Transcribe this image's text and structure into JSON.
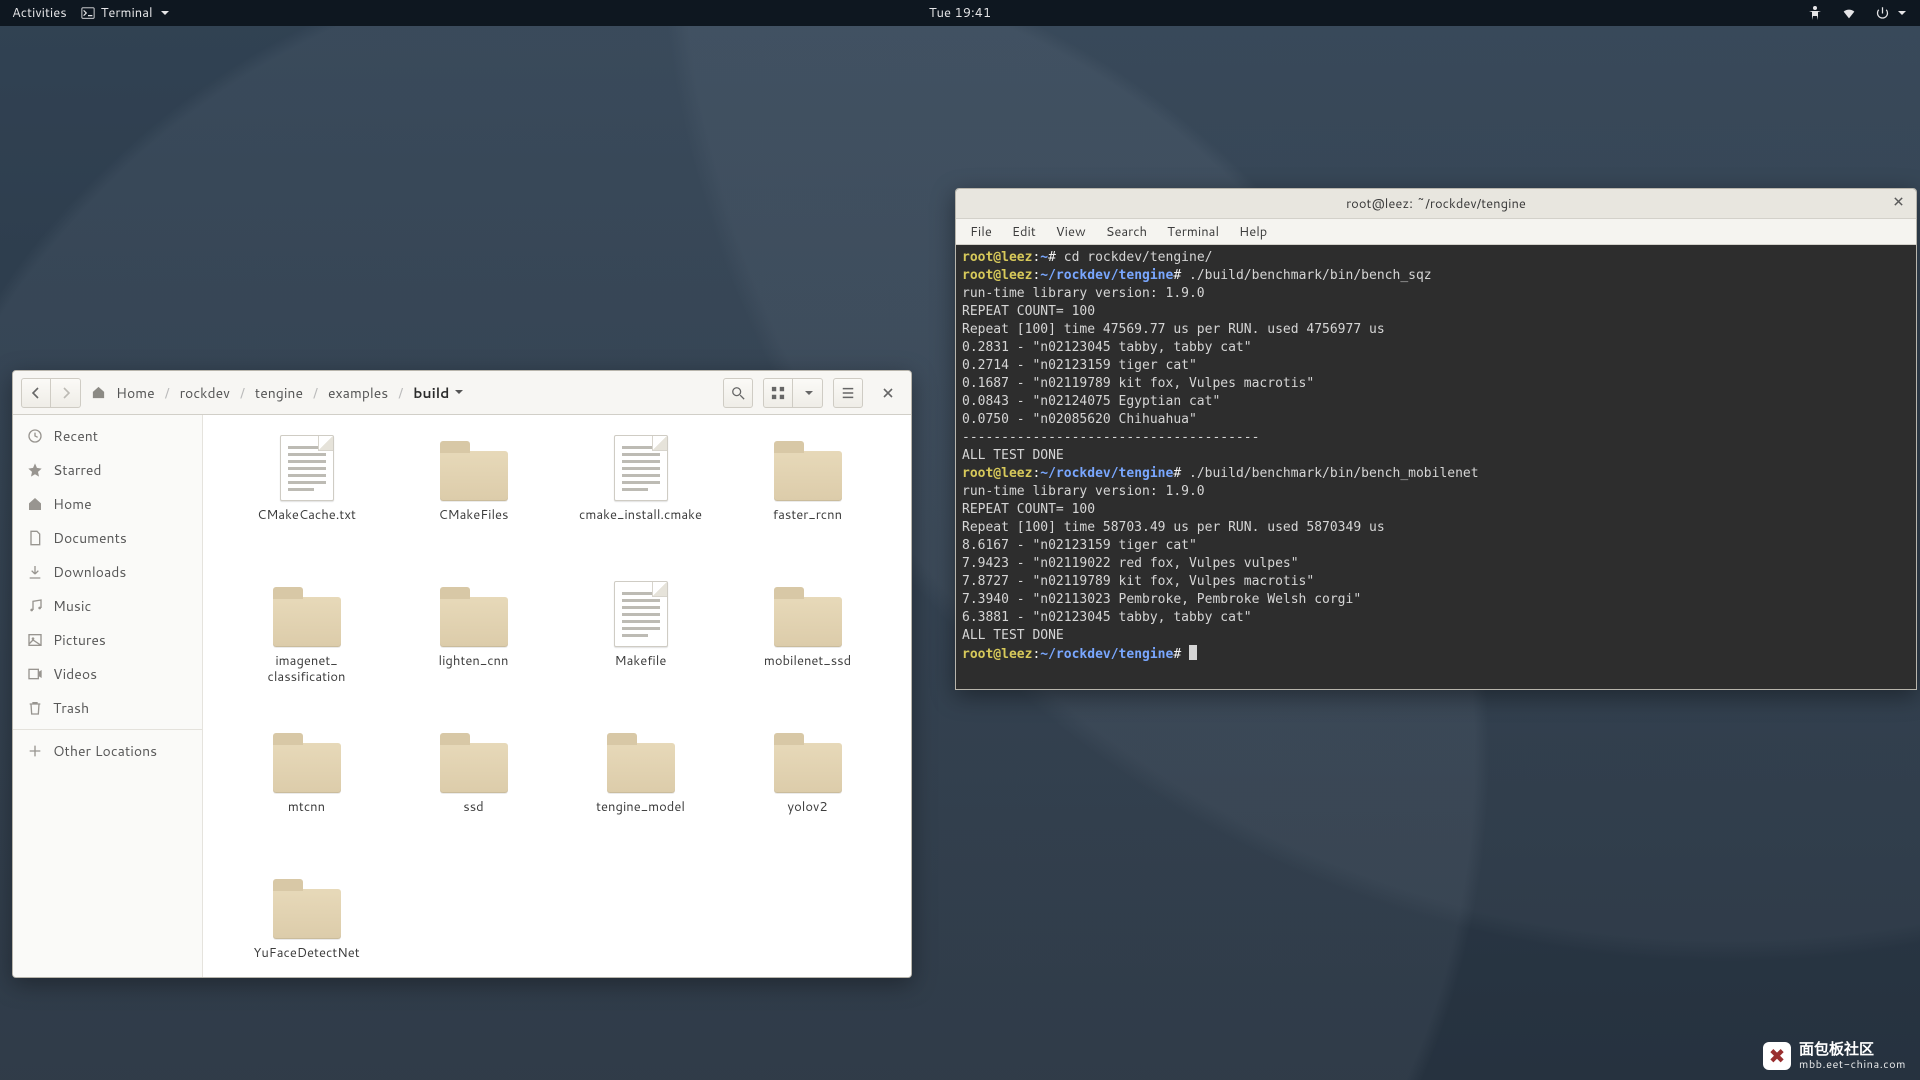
{
  "topbar": {
    "activities": "Activities",
    "app_label": "Terminal",
    "clock": "Tue 19:41"
  },
  "files": {
    "breadcrumb": [
      "Home",
      "rockdev",
      "tengine",
      "examples",
      "build"
    ],
    "sidebar": [
      {
        "icon": "clock",
        "label": "Recent"
      },
      {
        "icon": "star",
        "label": "Starred"
      },
      {
        "icon": "home",
        "label": "Home"
      },
      {
        "icon": "doc",
        "label": "Documents"
      },
      {
        "icon": "down",
        "label": "Downloads"
      },
      {
        "icon": "music",
        "label": "Music"
      },
      {
        "icon": "image",
        "label": "Pictures"
      },
      {
        "icon": "video",
        "label": "Videos"
      },
      {
        "icon": "trash",
        "label": "Trash"
      }
    ],
    "sidebar_other": {
      "icon": "plus",
      "label": "Other Locations"
    },
    "items": [
      {
        "kind": "file",
        "name": "CMakeCache.txt"
      },
      {
        "kind": "folder",
        "name": "CMakeFiles"
      },
      {
        "kind": "file",
        "name": "cmake_install.cmake"
      },
      {
        "kind": "folder",
        "name": "faster_rcnn"
      },
      {
        "kind": "folder",
        "name": "imagenet_\nclassification"
      },
      {
        "kind": "folder",
        "name": "lighten_cnn"
      },
      {
        "kind": "file",
        "name": "Makefile"
      },
      {
        "kind": "folder",
        "name": "mobilenet_ssd"
      },
      {
        "kind": "folder",
        "name": "mtcnn"
      },
      {
        "kind": "folder",
        "name": "ssd"
      },
      {
        "kind": "folder",
        "name": "tengine_model"
      },
      {
        "kind": "folder",
        "name": "yolov2"
      },
      {
        "kind": "folder",
        "name": "YuFaceDetectNet"
      }
    ]
  },
  "terminal": {
    "title": "root@leez: ~/rockdev/tengine",
    "menu": [
      "File",
      "Edit",
      "View",
      "Search",
      "Terminal",
      "Help"
    ],
    "prompt_user": "root@leez",
    "prompt_home_path": "~",
    "prompt_path": "~/rockdev/tengine",
    "lines": {
      "cmd1": "cd rockdev/tengine/",
      "cmd2": "./build/benchmark/bin/bench_sqz",
      "l1": "run-time library version: 1.9.0",
      "l2": "REPEAT COUNT= 100",
      "l3": "Repeat [100] time 47569.77 us per RUN. used 4756977 us",
      "l4": "0.2831 - \"n02123045 tabby, tabby cat\"",
      "l5": "0.2714 - \"n02123159 tiger cat\"",
      "l6": "0.1687 - \"n02119789 kit fox, Vulpes macrotis\"",
      "l7": "0.0843 - \"n02124075 Egyptian cat\"",
      "l8": "0.0750 - \"n02085620 Chihuahua\"",
      "dash": "--------------------------------------",
      "done": "ALL TEST DONE",
      "cmd3": "./build/benchmark/bin/bench_mobilenet",
      "m1": "run-time library version: 1.9.0",
      "m2": "REPEAT COUNT= 100",
      "m3": "Repeat [100] time 58703.49 us per RUN. used 5870349 us",
      "m4": "8.6167 - \"n02123159 tiger cat\"",
      "m5": "7.9423 - \"n02119022 red fox, Vulpes vulpes\"",
      "m6": "7.8727 - \"n02119789 kit fox, Vulpes macrotis\"",
      "m7": "7.3940 - \"n02113023 Pembroke, Pembroke Welsh corgi\"",
      "m8": "6.3881 - \"n02123045 tabby, tabby cat\"",
      "done2": "ALL TEST DONE"
    }
  },
  "watermark": {
    "big": "面包板社区",
    "small": "mbb.eet-china.com"
  }
}
